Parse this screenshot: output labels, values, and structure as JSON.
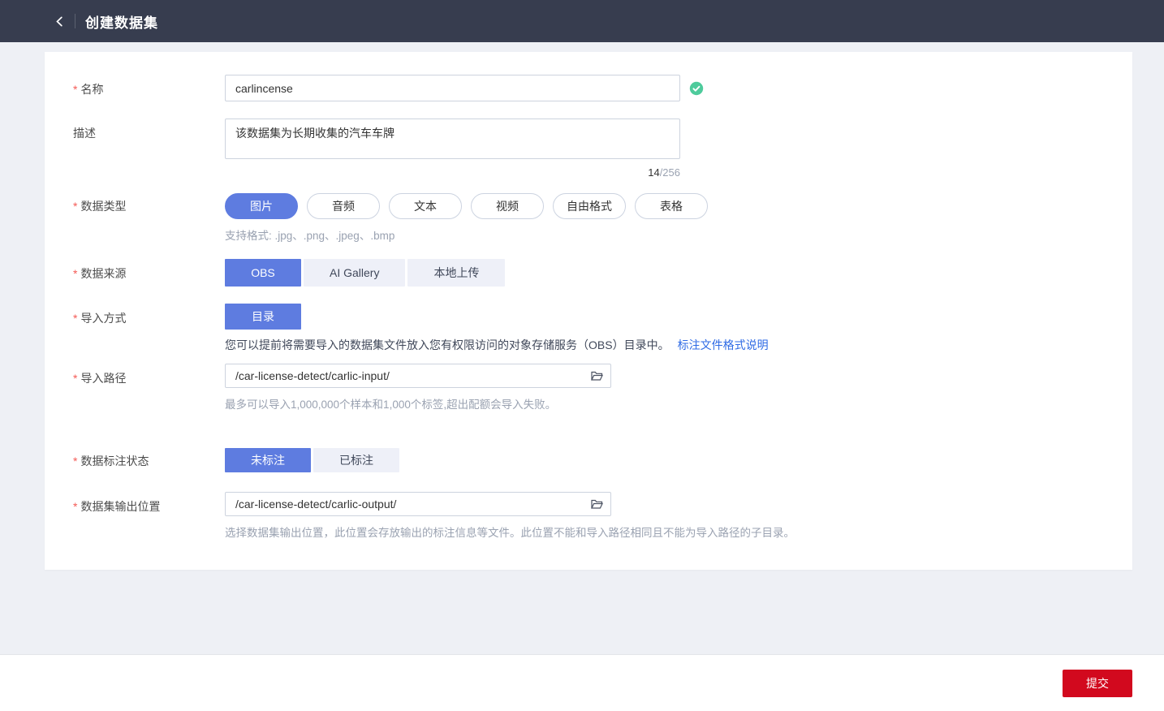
{
  "header": {
    "title": "创建数据集"
  },
  "asterisk": "*",
  "form": {
    "name": {
      "label": "名称",
      "value": "carlincense"
    },
    "description": {
      "label": "描述",
      "value": "该数据集为长期收集的汽车车牌",
      "count": "14",
      "max": "/256"
    },
    "data_type": {
      "label": "数据类型",
      "options": [
        "图片",
        "音频",
        "文本",
        "视频",
        "自由格式",
        "表格"
      ],
      "selected": "图片",
      "hint": "支持格式: .jpg、.png、.jpeg、.bmp"
    },
    "data_source": {
      "label": "数据来源",
      "options": [
        "OBS",
        "AI Gallery",
        "本地上传"
      ],
      "selected": "OBS"
    },
    "import_method": {
      "label": "导入方式",
      "options": [
        "目录"
      ],
      "selected": "目录",
      "hint": "您可以提前将需要导入的数据集文件放入您有权限访问的对象存储服务（OBS）目录中。",
      "hint_link": "标注文件格式说明"
    },
    "import_path": {
      "label": "导入路径",
      "value": "/car-license-detect/carlic-input/",
      "hint": "最多可以导入1,000,000个样本和1,000个标签,超出配额会导入失败。"
    },
    "label_status": {
      "label": "数据标注状态",
      "options": [
        "未标注",
        "已标注"
      ],
      "selected": "未标注"
    },
    "output_location": {
      "label": "数据集输出位置",
      "value": "/car-license-detect/carlic-output/",
      "hint": "选择数据集输出位置，此位置会存放输出的标注信息等文件。此位置不能和导入路径相同且不能为导入路径的子目录。"
    }
  },
  "footer": {
    "submit_label": "提交"
  },
  "colors": {
    "primary": "#5e7ce0",
    "success": "#4ecb9c",
    "danger": "#d2091e",
    "link": "#2f6be5",
    "header_bg": "#373d4f",
    "page_bg": "#eef0f5"
  }
}
